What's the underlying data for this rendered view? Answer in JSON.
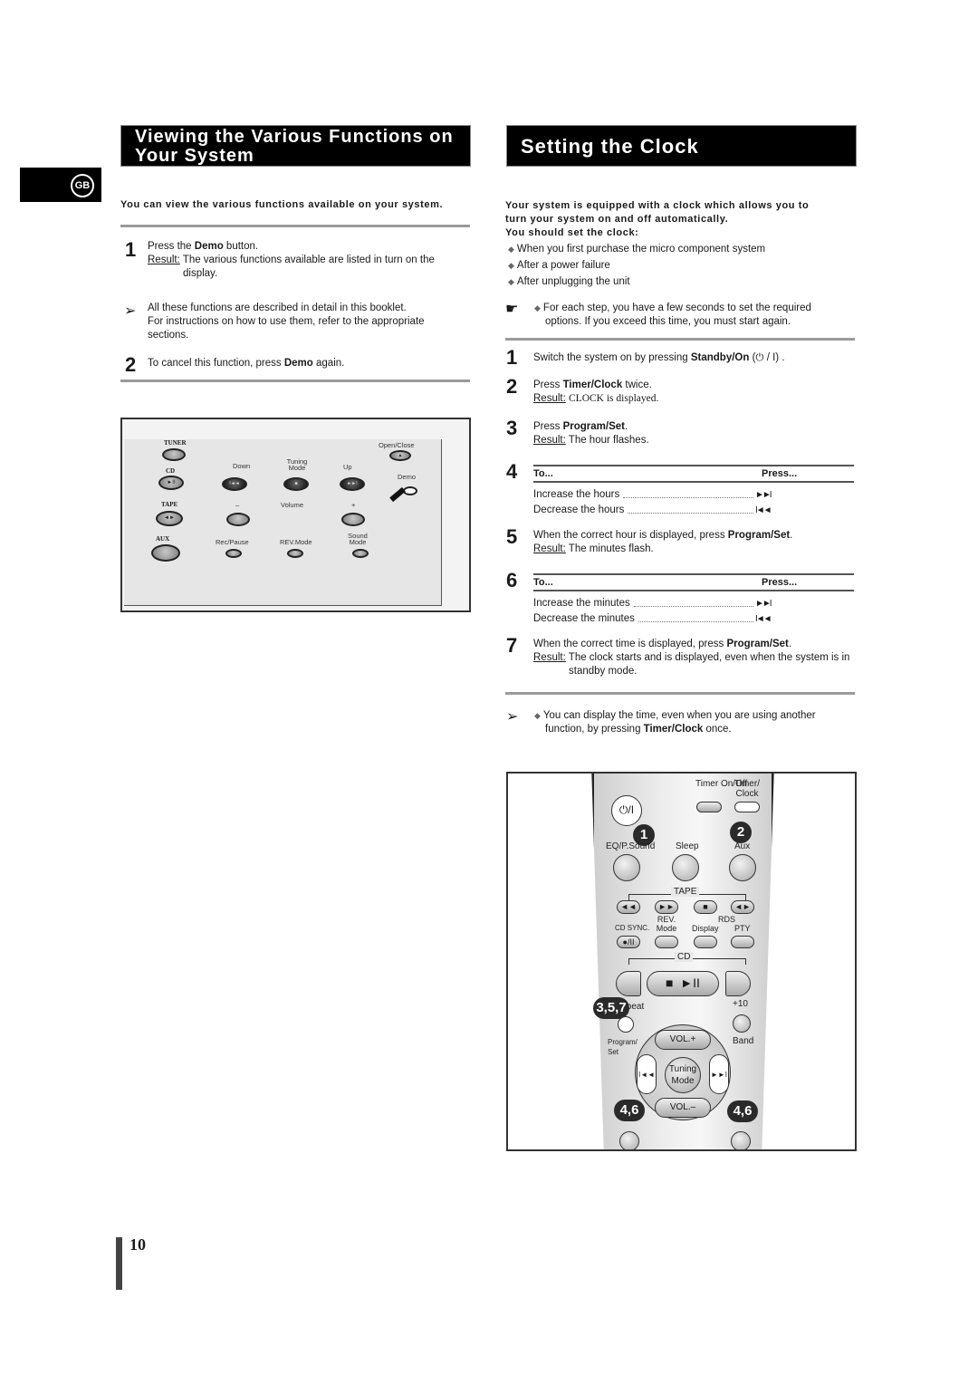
{
  "language_tab": "GB",
  "page_number": "10",
  "left": {
    "title_line1": "Viewing the Various Functions on",
    "title_line2": "Your System",
    "intro": "You can view the various functions available on your system.",
    "steps": [
      {
        "num": "1",
        "pre": "Press the ",
        "bold": "Demo",
        "post": " button.",
        "result_label": "Result:",
        "result_text": "The various functions available are listed in turn on the",
        "result_text2": "display."
      },
      {
        "num": "2",
        "pre": "To cancel this function, press ",
        "bold": "Demo",
        "post": " again."
      }
    ],
    "note_line1": "All these functions are described in detail in this booklet.",
    "note_line2": "For instructions on how to use them, refer to the appropriate",
    "note_line3": "sections.",
    "panel": {
      "tuner": "TUNER",
      "cd": "CD",
      "tape": "TAPE",
      "aux": "AUX",
      "down": "Down",
      "tuning_mode": "Tuning Mode",
      "up": "Up",
      "volume": "Volume",
      "minus": "–",
      "plus": "+",
      "rec_pause": "Rec/Pause",
      "rev_mode": "REV.Mode",
      "sound_mode": "Sound Mode",
      "open_close": "Open/Close",
      "demo": "Demo",
      "icon_play_pause": "►II",
      "icon_prev": "I◄◄",
      "icon_stop": "■",
      "icon_next": "►►I",
      "icon_tape": "◄►",
      "icon_eject": "▲"
    }
  },
  "right": {
    "title": "Setting the Clock",
    "intro_line1": "Your system is equipped with a clock which allows you to",
    "intro_line2": "turn your system on and off automatically.",
    "intro_line3": "You should set the clock:",
    "bullets": [
      "When you first purchase the micro component system",
      "After a power failure",
      "After unplugging the unit"
    ],
    "tip_line1": "For each step, you have a few seconds to set the required",
    "tip_line2": "options. If you exceed this time, you must start again.",
    "steps": {
      "s1": {
        "num": "1",
        "pre": "Switch the system on by pressing ",
        "bold": "Standby/On",
        "post": " (⏻ / I) ."
      },
      "s2": {
        "num": "2",
        "pre": "Press ",
        "bold": "Timer/Clock",
        "post": " twice.",
        "result_label": "Result:",
        "result_text": "CLOCK is displayed."
      },
      "s3": {
        "num": "3",
        "pre": "Press ",
        "bold": "Program/Set",
        "post": ".",
        "result_label": "Result:",
        "result_text": "The hour flashes."
      },
      "s4": {
        "num": "4",
        "col_to": "To...",
        "col_press": "Press...",
        "rows": [
          {
            "label": "Increase the hours",
            "icon": "►►I"
          },
          {
            "label": "Decrease the hours",
            "icon": "I◄◄"
          }
        ]
      },
      "s5": {
        "num": "5",
        "pre": "When the correct hour is displayed, press ",
        "bold": "Program/Set",
        "post": ".",
        "result_label": "Result:",
        "result_text": "The minutes flash."
      },
      "s6": {
        "num": "6",
        "col_to": "To...",
        "col_press": "Press...",
        "rows": [
          {
            "label": "Increase the minutes",
            "icon": "►►I"
          },
          {
            "label": "Decrease the minutes",
            "icon": "I◄◄"
          }
        ]
      },
      "s7": {
        "num": "7",
        "pre": "When the correct time is displayed, press ",
        "bold": "Program/Set",
        "post": ".",
        "result_label": "Result:",
        "result_text": "The clock starts and is displayed, even when the system is in",
        "result_text2": "standby mode."
      }
    },
    "note_line1": "You can display the time, even when you are using another",
    "note_pre": "function, by pressing ",
    "note_bold": "Timer/Clock",
    "note_post": " once.",
    "remote": {
      "power": "⏻/I",
      "timer_onoff": "Timer On/Off",
      "timer_clock": "Timer/ Clock",
      "eq": "EQ/P.Sound",
      "sleep": "Sleep",
      "aux": "Aux",
      "tape": "TAPE",
      "cd_sync": "CD SYNC.",
      "rev_mode": "REV. Mode",
      "rds": "RDS",
      "display": "Display",
      "pty": "PTY",
      "cd": "CD",
      "repeat": "Repeat",
      "plus10": "+10",
      "program_set": "Program/ Set",
      "band": "Band",
      "vol_plus": "VOL.+",
      "vol_minus": "VOL.–",
      "tuning_mode": "Tuning Mode",
      "icon_rew": "◄◄",
      "icon_ff": "►►",
      "icon_stop": "■",
      "icon_dir": "◄►",
      "icon_rec": "●/II",
      "icon_play": "►II",
      "icon_prev": "I◄◄",
      "icon_next": "►►I",
      "callouts": [
        "1",
        "2",
        "3,5,7",
        "4,6",
        "4,6"
      ]
    }
  }
}
